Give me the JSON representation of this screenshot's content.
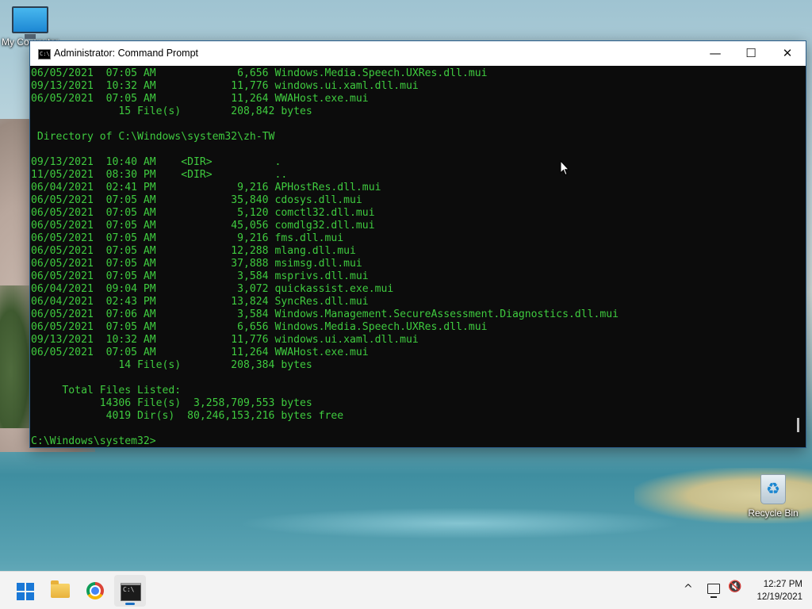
{
  "desktop": {
    "icons": [
      {
        "label": "My Computer"
      },
      {
        "label": "Recycle Bin"
      }
    ]
  },
  "window": {
    "title": "Administrator: Command Prompt",
    "controls": {
      "minimize": "—",
      "maximize": "☐",
      "close": "✕"
    }
  },
  "console": {
    "lines": [
      "06/05/2021  07:05 AM             6,656 Windows.Media.Speech.UXRes.dll.mui",
      "09/13/2021  10:32 AM            11,776 windows.ui.xaml.dll.mui",
      "06/05/2021  07:05 AM            11,264 WWAHost.exe.mui",
      "              15 File(s)        208,842 bytes",
      "",
      " Directory of C:\\Windows\\system32\\zh-TW",
      "",
      "09/13/2021  10:40 AM    <DIR>          .",
      "11/05/2021  08:30 PM    <DIR>          ..",
      "06/04/2021  02:41 PM             9,216 APHostRes.dll.mui",
      "06/05/2021  07:05 AM            35,840 cdosys.dll.mui",
      "06/05/2021  07:05 AM             5,120 comctl32.dll.mui",
      "06/05/2021  07:05 AM            45,056 comdlg32.dll.mui",
      "06/05/2021  07:05 AM             9,216 fms.dll.mui",
      "06/05/2021  07:05 AM            12,288 mlang.dll.mui",
      "06/05/2021  07:05 AM            37,888 msimsg.dll.mui",
      "06/05/2021  07:05 AM             3,584 msprivs.dll.mui",
      "06/04/2021  09:04 PM             3,072 quickassist.exe.mui",
      "06/04/2021  02:43 PM            13,824 SyncRes.dll.mui",
      "06/05/2021  07:06 AM             3,584 Windows.Management.SecureAssessment.Diagnostics.dll.mui",
      "06/05/2021  07:05 AM             6,656 Windows.Media.Speech.UXRes.dll.mui",
      "09/13/2021  10:32 AM            11,776 windows.ui.xaml.dll.mui",
      "06/05/2021  07:05 AM            11,264 WWAHost.exe.mui",
      "              14 File(s)        208,384 bytes",
      "",
      "     Total Files Listed:",
      "           14306 File(s)  3,258,709,553 bytes",
      "            4019 Dir(s)  80,246,153,216 bytes free",
      "",
      "C:\\Windows\\system32>"
    ]
  },
  "taskbar": {
    "apps": [
      {
        "name": "start-icon"
      },
      {
        "name": "file-explorer-icon"
      },
      {
        "name": "chrome-icon"
      },
      {
        "name": "command-prompt-icon"
      }
    ],
    "tray": {
      "chevron": "^",
      "time": "12:27 PM",
      "date": "12/19/2021"
    }
  },
  "colors": {
    "console_background": "#0c0c0c",
    "console_text": "#3fcb3f",
    "taskbar": "#f3f3f3",
    "accent": "#1a78d6"
  }
}
